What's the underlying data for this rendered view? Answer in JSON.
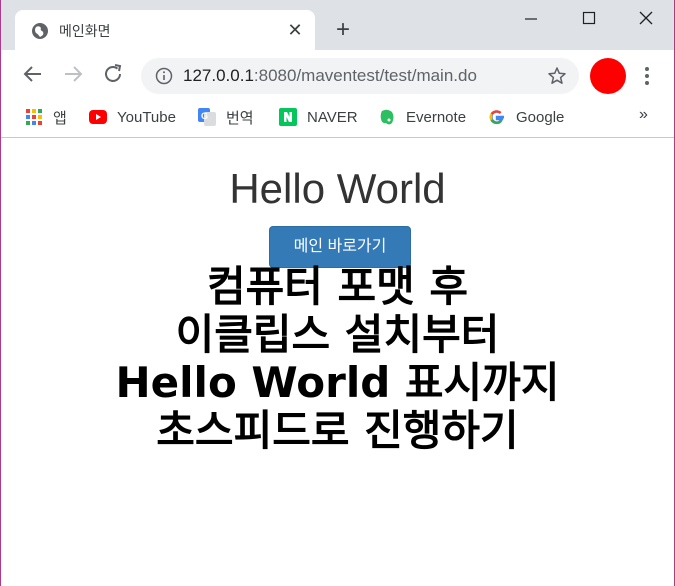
{
  "browser": {
    "tab": {
      "title": "메인화면",
      "close_glyph": "✕",
      "favicon": "globe-icon"
    },
    "new_tab_glyph": "+",
    "address": {
      "host": "127.0.0.1",
      "rest": ":8080/maventest/test/main.do"
    },
    "profile_color": "#ff0000",
    "bookmarks": [
      {
        "label": "앱",
        "icon": "apps-grid-icon"
      },
      {
        "label": "YouTube",
        "icon": "youtube-icon"
      },
      {
        "label": "번역",
        "icon": "translate-icon"
      },
      {
        "label": "NAVER",
        "icon": "naver-icon"
      },
      {
        "label": "Evernote",
        "icon": "evernote-icon"
      },
      {
        "label": "Google",
        "icon": "google-icon"
      }
    ],
    "more_glyph": "»"
  },
  "page": {
    "heading": "Hello World",
    "main_button": "메인 바로가기",
    "headline_lines": [
      "컴퓨터 포맷 후",
      "이클립스 설치부터",
      "Hello World 표시까지",
      "초스피드로 진행하기"
    ],
    "button_color": "#337ab7"
  }
}
